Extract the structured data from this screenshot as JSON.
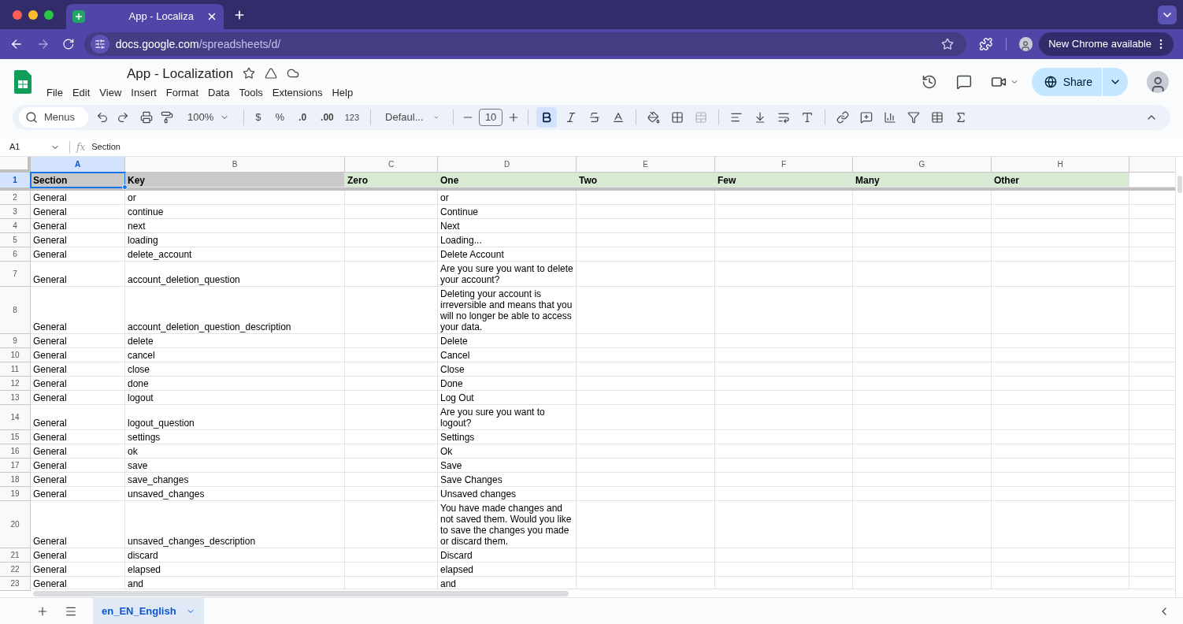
{
  "browser": {
    "tab_title": "App - Localiza",
    "url_host": "docs.google.com",
    "url_path": "/spreadsheets/d/",
    "update_button": "New Chrome available"
  },
  "doc": {
    "title": "App - Localization",
    "menu": [
      "File",
      "Edit",
      "View",
      "Insert",
      "Format",
      "Data",
      "Tools",
      "Extensions",
      "Help"
    ],
    "share": "Share"
  },
  "toolbar": {
    "search": "Menus",
    "zoom": "100%",
    "currency": "$",
    "percent": "%",
    "decimal_decrease": ".0",
    "decimal_increase": ".00",
    "number_format": "123",
    "font": "Defaul...",
    "font_size": "10",
    "bold_active": true
  },
  "formula_bar": {
    "cell_ref": "A1",
    "fx": "fx",
    "content": "Section"
  },
  "columns": [
    {
      "letter": "A",
      "selected": true
    },
    {
      "letter": "B",
      "selected": false
    },
    {
      "letter": "C",
      "selected": false
    },
    {
      "letter": "D",
      "selected": false
    },
    {
      "letter": "E",
      "selected": false
    },
    {
      "letter": "F",
      "selected": false
    },
    {
      "letter": "G",
      "selected": false
    },
    {
      "letter": "H",
      "selected": false
    }
  ],
  "header_row": {
    "number": "1",
    "selected": true,
    "cells": [
      "Section",
      "Key",
      "Zero",
      "One",
      "Two",
      "Few",
      "Many",
      "Other"
    ]
  },
  "rows": [
    {
      "number": "2",
      "section": "General",
      "key": "or",
      "one": "or"
    },
    {
      "number": "3",
      "section": "General",
      "key": "continue",
      "one": "Continue"
    },
    {
      "number": "4",
      "section": "General",
      "key": "next",
      "one": "Next"
    },
    {
      "number": "5",
      "section": "General",
      "key": "loading",
      "one": "Loading..."
    },
    {
      "number": "6",
      "section": "General",
      "key": "delete_account",
      "one": "Delete Account"
    },
    {
      "number": "7",
      "section": "General",
      "key": "account_deletion_question",
      "one": "Are you sure you want to delete your account?"
    },
    {
      "number": "8",
      "section": "General",
      "key": "account_deletion_question_description",
      "one": "Deleting your account is irreversible and means that you will no longer be able to access your data."
    },
    {
      "number": "9",
      "section": "General",
      "key": "delete",
      "one": "Delete"
    },
    {
      "number": "10",
      "section": "General",
      "key": "cancel",
      "one": "Cancel"
    },
    {
      "number": "11",
      "section": "General",
      "key": "close",
      "one": "Close"
    },
    {
      "number": "12",
      "section": "General",
      "key": "done",
      "one": "Done"
    },
    {
      "number": "13",
      "section": "General",
      "key": "logout",
      "one": "Log Out"
    },
    {
      "number": "14",
      "section": "General",
      "key": "logout_question",
      "one": "Are you sure you want to logout?"
    },
    {
      "number": "15",
      "section": "General",
      "key": "settings",
      "one": "Settings"
    },
    {
      "number": "16",
      "section": "General",
      "key": "ok",
      "one": "Ok"
    },
    {
      "number": "17",
      "section": "General",
      "key": "save",
      "one": "Save"
    },
    {
      "number": "18",
      "section": "General",
      "key": "save_changes",
      "one": "Save Changes"
    },
    {
      "number": "19",
      "section": "General",
      "key": "unsaved_changes",
      "one": "Unsaved changes"
    },
    {
      "number": "20",
      "section": "General",
      "key": "unsaved_changes_description",
      "one": "You have made changes and not saved them. Would you like to save the changes you made or discard them."
    },
    {
      "number": "21",
      "section": "General",
      "key": "discard",
      "one": "Discard"
    },
    {
      "number": "22",
      "section": "General",
      "key": "elapsed",
      "one": "elapsed"
    },
    {
      "number": "23",
      "section": "General",
      "key": "and",
      "one": "and"
    }
  ],
  "sheet_tabs": [
    {
      "label": "en_EN_English",
      "selected": true
    }
  ]
}
